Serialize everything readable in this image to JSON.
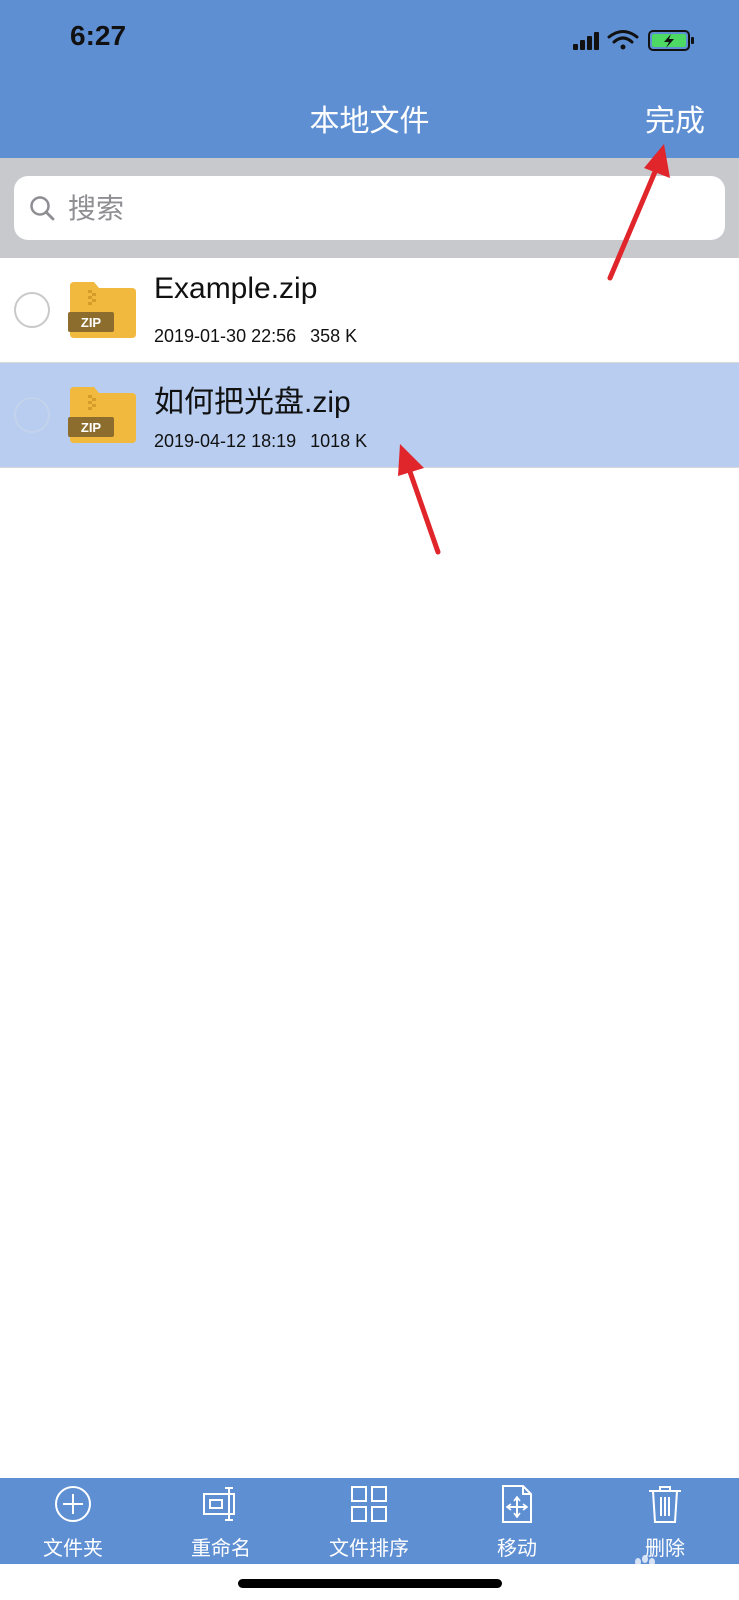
{
  "status_bar": {
    "time": "6:27"
  },
  "nav": {
    "title": "本地文件",
    "done_label": "完成"
  },
  "search": {
    "placeholder": "搜索",
    "value": ""
  },
  "files": [
    {
      "name": "Example.zip",
      "date": "2019-01-30 22:56",
      "size": "358 K",
      "selected": false,
      "badge": "ZIP"
    },
    {
      "name": "如何把光盘.zip",
      "date": "2019-04-12 18:19",
      "size": "1018 K",
      "selected": true,
      "badge": "ZIP"
    }
  ],
  "toolbar": [
    {
      "label": "文件夹",
      "icon": "plus-circle-icon"
    },
    {
      "label": "重命名",
      "icon": "rename-icon"
    },
    {
      "label": "文件排序",
      "icon": "grid-icon"
    },
    {
      "label": "移动",
      "icon": "move-icon"
    },
    {
      "label": "删除",
      "icon": "trash-icon"
    }
  ],
  "colors": {
    "header_bg": "#5f8fd3",
    "selected_row": "#b8cdef",
    "zip_yellow": "#f2b93f",
    "zip_badge": "#8c6d2e",
    "annotation_red": "#e0252b"
  }
}
